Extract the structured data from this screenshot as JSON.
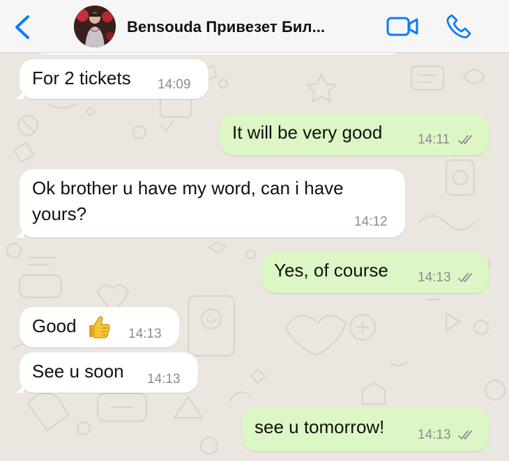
{
  "header": {
    "title": "Bensouda Привезет Бил...",
    "back_icon": "chevron-left-icon",
    "video_icon": "video-camera-icon",
    "call_icon": "phone-icon",
    "accent": "#0a7aff"
  },
  "colors": {
    "incoming_bubble": "#ffffff",
    "outgoing_bubble": "#dcf7c5",
    "wallpaper": "#ebe6df",
    "read_ticks": "#8c8c8c"
  },
  "messages": [
    {
      "direction": "incoming",
      "text": "For 2 tickets",
      "time": "14:09"
    },
    {
      "direction": "outgoing",
      "text": "It will be very good",
      "time": "14:11",
      "status": "read"
    },
    {
      "direction": "incoming",
      "text_line1": "Ok brother u have my word, can i have",
      "text_line2": "yours?",
      "time": "14:12"
    },
    {
      "direction": "outgoing",
      "text": "Yes, of course",
      "time": "14:13",
      "status": "read"
    },
    {
      "direction": "incoming",
      "text": "Good",
      "emoji": "👍",
      "emoji_icon": "thumbs-up-icon",
      "time": "14:13"
    },
    {
      "direction": "incoming",
      "text": "See u soon",
      "time": "14:13"
    },
    {
      "direction": "outgoing",
      "text": "see u tomorrow!",
      "time": "14:13",
      "status": "read"
    }
  ]
}
